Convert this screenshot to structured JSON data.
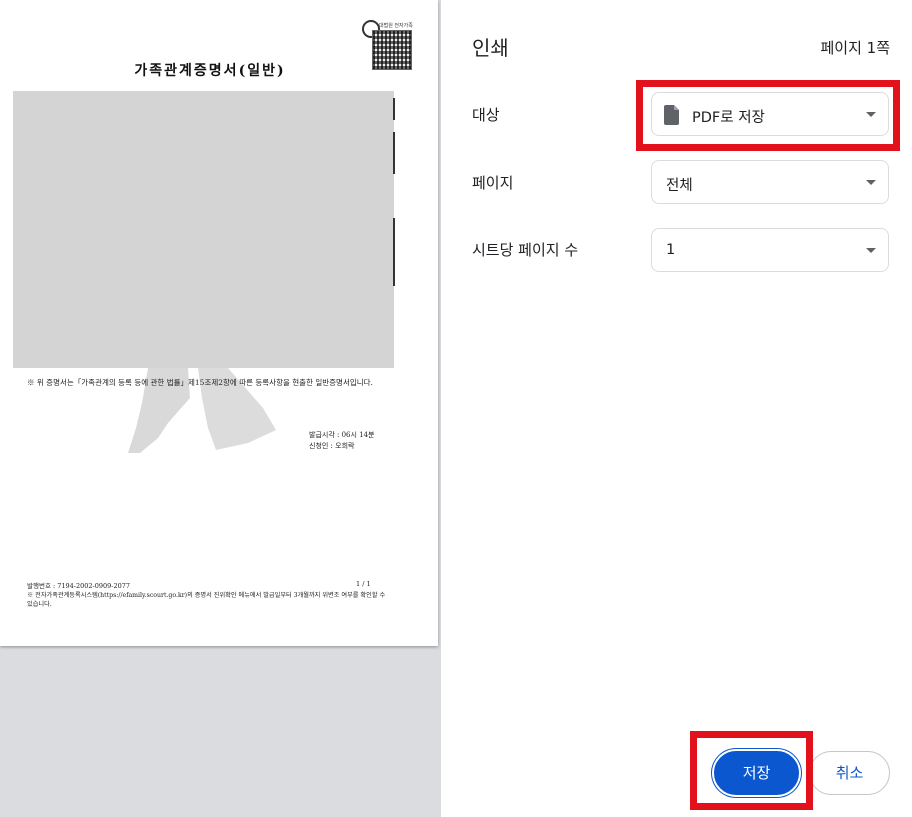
{
  "preview": {
    "doc_title": "가족관계증명서(일반)",
    "qr_caption": "대법원 전자가족",
    "doc_note": "※ 위 증명서는「가족관계의 등록 등에 관한 법률」제15조제2항에 따른 등록사항을 현출한 일반증명서입니다.",
    "issue_time": "발급시각 : 06시 14분",
    "applicant": "신청인 : 오희락",
    "issue_number": "발행번호 : 7194-2002-0909-2077",
    "page_indicator": "1 / 1",
    "footer_note": "※ 전자가족관계등록시스템(https://efamily.scourt.go.kr)의 증명서 진위확인 메뉴에서 발급일부터 3개월까지 위변조 여부를 확인할 수 있습니다."
  },
  "panel": {
    "title": "인쇄",
    "page_count": "페이지 1쪽",
    "destination": {
      "label": "대상",
      "value": "PDF로 저장",
      "icon": "file-icon"
    },
    "pages": {
      "label": "페이지",
      "value": "전체"
    },
    "pages_per_sheet": {
      "label": "시트당 페이지 수",
      "value": "1"
    },
    "save_label": "저장",
    "cancel_label": "취소"
  },
  "colors": {
    "accent": "#0b57d0",
    "highlight": "#e3111b",
    "preview_bg": "#dadce0",
    "redaction": "#d4d4d4"
  }
}
